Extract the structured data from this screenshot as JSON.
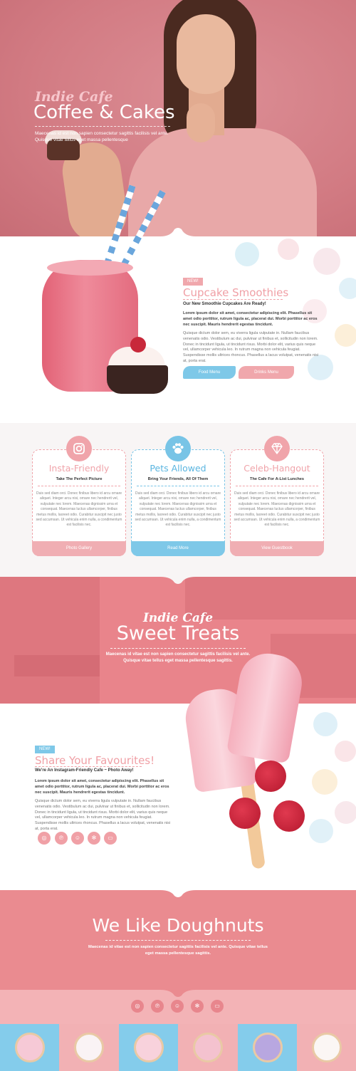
{
  "hero": {
    "script": "Indie Cafe",
    "title": "Coffee & Cakes",
    "subtitle": "Maecenas id est non sapien consectetur sagittis facilisis vel ante. Quisque vitae tellus eget massa pellentesque"
  },
  "smoothies": {
    "badge": "NEW!",
    "heading": "Cupcake Smoothies",
    "bold": "Our New Smoothie Cupcakes Are Ready!",
    "lead": "Lorem ipsum dolor sit amet, consectetur adipiscing elit. Phasellus sit amet odio porttitor, rutrum ligula ac, placerat dui. Morbi porttitor ac eros nec suscipit. Mauris hendrerit egestas tincidunt.",
    "body": "Quisque dictum dolor sem, eu viverra ligula vulputate in. Nullam faucibus venenatis odio. Vestibulum ac dui, pulvinar ut finibus et, sollicitudin non lorem. Donec in tincidunt ligula, ut tincidunt risus. Morbi dolor elit, varius quis neque vel, ullamcorper vehicula leo. In rutrum magna non vehicula feugiat. Suspendisse mollis ultrices rhoncus. Phasellus a lacus volutpat, venenatis nisi at, porta erat.",
    "btn_food": "Food Menu",
    "btn_drinks": "Drinks Menu"
  },
  "features": [
    {
      "title": "Insta-Friendly",
      "sub": "Take The Perfect Picture",
      "body": "Duis sed diam orci. Donec finibus libero id arcu ornare aliquet. Integer arcu nisi, ornare nec hendrerit vel, vulputate nec lorem. Maecenas dignissim urna et consequat. Maecenas luctus ullamcorper, finibus metus mollis, laoreet odio. Curabitur suscipit nec justo sed accumsan. Ut vehicula enim nulla, a condimentum est facilisis nec.",
      "button": "Photo Gallery",
      "icon": "instagram-icon"
    },
    {
      "title": "Pets Allowed",
      "sub": "Bring Your Friends, All Of Them",
      "body": "Duis sed diam orci. Donec finibus libero id arcu ornare aliquet. Integer arcu nisi, ornare nec hendrerit vel, vulputate nec lorem. Maecenas dignissim urna et consequat. Maecenas luctus ullamcorper, finibus metus mollis, laoreet odio. Curabitur suscipit nec justo sed accumsan. Ut vehicula enim nulla, a condimentum est facilisis nec.",
      "button": "Read More",
      "icon": "paw-icon"
    },
    {
      "title": "Celeb-Hangout",
      "sub": "The Cafe For A-List Lunches",
      "body": "Duis sed diam orci. Donec finibus libero id arcu ornare aliquet. Integer arcu nisi, ornare nec hendrerit vel, vulputate nec lorem. Maecenas dignissim urna et consequat. Maecenas luctus ullamcorper, finibus metus mollis, laoreet odio. Curabitur suscipit nec justo sed accumsan. Ut vehicula enim nulla, a condimentum est facilisis nec.",
      "button": "View Guestbook",
      "icon": "diamond-icon"
    }
  ],
  "treats": {
    "script": "Indie Cafe",
    "title": "Sweet Treats",
    "subtitle": "Maecenas id vitae est non sapien consectetur sagittis facilisis vel ante. Quisque vitae tellus eget massa pellentesque sagittis."
  },
  "favourites": {
    "badge": "NEW!",
    "heading": "Share Your Favourites!",
    "bold": "We're An Instagram-Friendly Cafe ~ Photo Away!",
    "lead": "Lorem ipsum dolor sit amet, consectetur adipiscing elit. Phasellus sit amet odio porttitor, rutrum ligula ac, placerat dui. Morbi porttitor ac eros nec suscipit. Mauris hendrerit egestas tincidunt.",
    "body": "Quisque dictum dolor sem, eu viverra ligula vulputate in. Nullam faucibus venenatis odio. Vestibulum ac dui, pulvinar ut finibus et, sollicitudin non lorem. Donec in tincidunt ligula, ut tincidunt risus. Morbi dolor elit, varius quis neque vel, ullamcorper vehicula leo. In rutrum magna non vehicula feugiat. Suspendisse mollis ultrices rhoncus. Phasellus a lacus volutpat, venenatis nisi at, porta erat."
  },
  "doughnuts": {
    "title": "We Like Doughnuts",
    "subtitle": "Maecenas id vitae est non sapien consectetur sagittis facilisis vel ante. Quisque vitae tellus eget massa pellentesque sagittis."
  },
  "social_icons": [
    "instagram-icon",
    "pinterest-icon",
    "snapchat-icon",
    "yelp-icon",
    "flickr-icon"
  ],
  "colors": {
    "pink": "#f0a0a6",
    "blue": "#7ec8e8",
    "coral": "#e9848b"
  }
}
